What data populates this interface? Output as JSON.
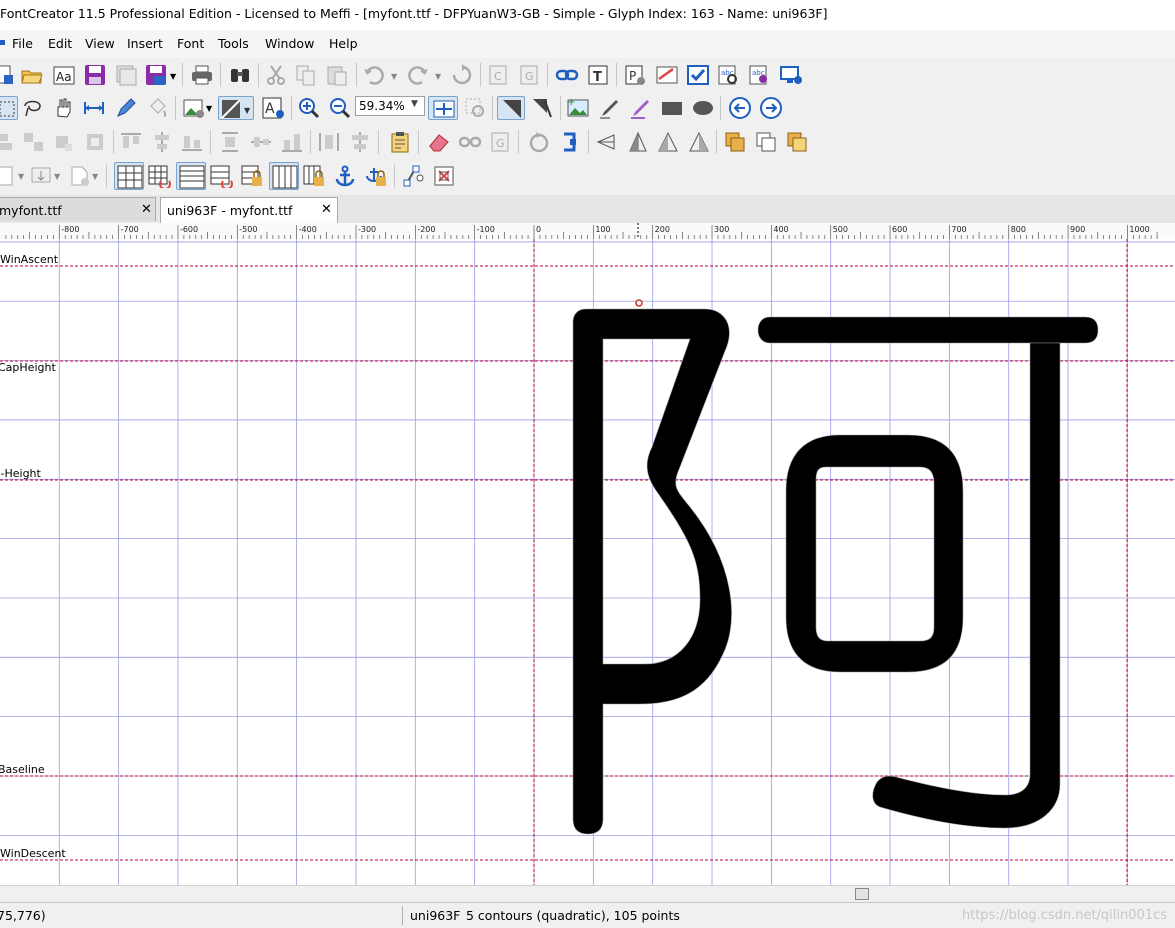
{
  "window": {
    "title": "FontCreator 11.5 Professional Edition - Licensed to Meffi - [myfont.ttf - DFPYuanW3-GB - Simple - Glyph Index: 163 - Name: uni963F]"
  },
  "menu": {
    "items": [
      "File",
      "Edit",
      "View",
      "Insert",
      "Font",
      "Tools",
      "Window",
      "Help"
    ]
  },
  "toolbar": {
    "zoom_value": "59.34%"
  },
  "tabs": [
    {
      "label": "myfont.ttf",
      "active": false
    },
    {
      "label": "uni963F - myfont.ttf",
      "active": true
    }
  ],
  "ruler": {
    "ticks": [
      "-800",
      "-700",
      "-600",
      "-500",
      "-400",
      "-300",
      "-200",
      "-100",
      "0",
      "100",
      "200",
      "300",
      "400",
      "500",
      "600",
      "700",
      "800",
      "900",
      "1000"
    ]
  },
  "guides": {
    "win_ascent": "WinAscent",
    "cap_height": "CapHeight",
    "x_height": "x-Height",
    "baseline": "Baseline",
    "win_descent": "WinDescent"
  },
  "glyph": {
    "character": "阿",
    "name": "uni963F"
  },
  "status": {
    "cursor": "75,776)",
    "glyph_name": "uni963F",
    "info": "5 contours (quadratic), 105 points",
    "watermark": "https://blog.csdn.net/qilin001cs"
  },
  "colors": {
    "guide_line": "#c00033",
    "grid_line": "#9b9be6",
    "selection_bg": "#d7e4f2"
  }
}
